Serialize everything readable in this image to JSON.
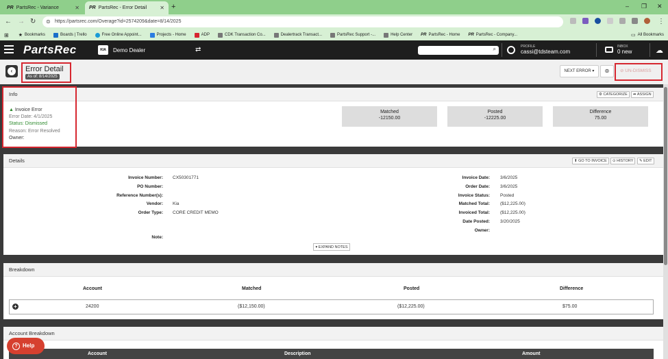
{
  "browser": {
    "tabs": [
      {
        "label": "PartsRec - Variance"
      },
      {
        "label": "PartsRec - Error Detail"
      }
    ],
    "url": "https://partsrec.com/Overage?id=2574209&date=8/14/2025",
    "bookmarks": [
      {
        "label": "Bookmarks",
        "color": "#333333"
      },
      {
        "label": "Boards | Trello",
        "color": "#1a6fc9"
      },
      {
        "label": "Free Online Appoint...",
        "color": "#1a9bd6"
      },
      {
        "label": "Projects - Home",
        "color": "#2a7de1"
      },
      {
        "label": "ADP",
        "color": "#d6262f"
      },
      {
        "label": "CDK Transaction Co...",
        "color": "#777777"
      },
      {
        "label": "Dealertrack Transact...",
        "color": "#777777"
      },
      {
        "label": "PartsRec Support -...",
        "color": "#777777"
      },
      {
        "label": "Help Center",
        "color": "#777777"
      },
      {
        "label": "PartsRec - Home",
        "color": "#333333"
      },
      {
        "label": "PartsRec - Company...",
        "color": "#333333"
      }
    ],
    "all_bookmarks": "All Bookmarks"
  },
  "header": {
    "brand": "PartsRec",
    "dealer_logo": "KIA",
    "dealer": "Demo Dealer",
    "profile_label": "PROFILE",
    "profile_email": "cassi@tdsteam.com",
    "inbox_label": "INBOX",
    "inbox_count": "0 new"
  },
  "titlebar": {
    "title": "Error Detail",
    "as_of": "As of: 8/14/2025",
    "next_error": "NEXT ERROR ▾",
    "undismiss": "UN-DISMISS"
  },
  "info": {
    "header": "Info",
    "categorize": "CATEGORIZE",
    "assign": "ASSIGN",
    "error_type": "Invoice Error",
    "error_date": "Error Date: 4/1/2025",
    "status": "Status: Dismissed",
    "reason": "Reason: Error Resolved",
    "owner": "Owner:",
    "stats": [
      {
        "label": "Matched",
        "value": "-12150.00"
      },
      {
        "label": "Posted",
        "value": "-12225.00"
      },
      {
        "label": "Difference",
        "value": "75.00"
      }
    ]
  },
  "details": {
    "header": "Details",
    "go_to_invoice": "GO TO INVOICE",
    "history": "HISTORY",
    "edit": "EDIT",
    "left": [
      {
        "label": "Invoice Number:",
        "value": "CX50301771"
      },
      {
        "label": "PO Number:",
        "value": ""
      },
      {
        "label": "Reference Number(s):",
        "value": ""
      },
      {
        "label": "Vendor:",
        "value": "Kia"
      },
      {
        "label": "Order Type:",
        "value": "CORE CREDIT MEMO"
      }
    ],
    "note_label": "Note:",
    "right": [
      {
        "label": "Invoice Date:",
        "value": "3/6/2025"
      },
      {
        "label": "Order Date:",
        "value": "3/6/2025"
      },
      {
        "label": "Invoice Status:",
        "value": "Posted"
      },
      {
        "label": "Matched Total:",
        "value": "($12,225.00)"
      },
      {
        "label": "Invoiced Total:",
        "value": "($12,225.00)"
      },
      {
        "label": "Date Posted:",
        "value": "3/20/2025"
      },
      {
        "label": "Owner:",
        "value": ""
      }
    ],
    "expand_notes": "EXPAND NOTES"
  },
  "breakdown": {
    "header": "Breakdown",
    "columns": [
      "Account",
      "Matched",
      "Posted",
      "Difference"
    ],
    "rows": [
      {
        "account": "24200",
        "matched": "($12,150.00)",
        "posted": "($12,225.00)",
        "difference": "$75.00"
      }
    ]
  },
  "account_breakdown": {
    "header": "Account Breakdown",
    "columns": [
      "Account",
      "Description",
      "Amount"
    ]
  },
  "help": "Help",
  "colors": {
    "tab_strip": "#8fcf8b",
    "app_header": "#1e1e1e",
    "highlight": "#d6262f",
    "status_green": "#2e8b2e"
  }
}
